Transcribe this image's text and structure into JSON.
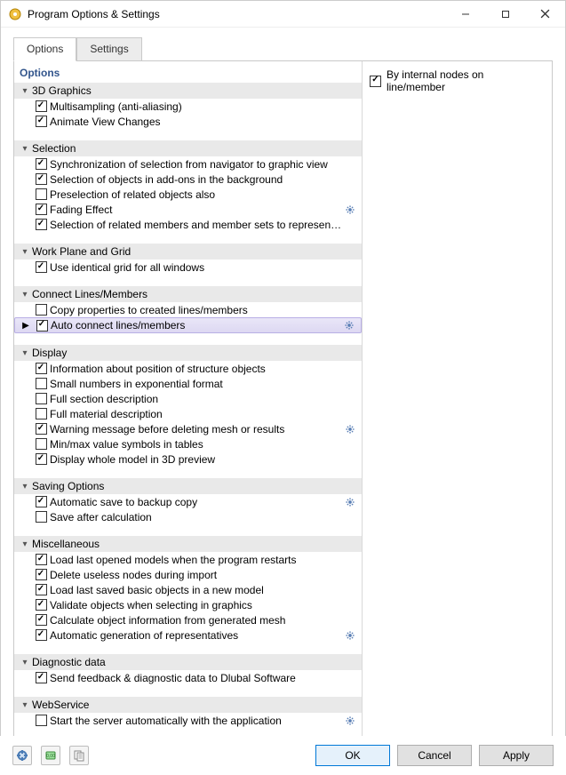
{
  "window": {
    "title": "Program Options & Settings"
  },
  "tabs": {
    "options": "Options",
    "settings": "Settings"
  },
  "panel_title": "Options",
  "groups": [
    {
      "label": "3D Graphics",
      "items": [
        {
          "label": "Multisampling (anti-aliasing)",
          "checked": true
        },
        {
          "label": "Animate View Changes",
          "checked": true
        }
      ]
    },
    {
      "label": "Selection",
      "items": [
        {
          "label": "Synchronization of selection from navigator to graphic view",
          "checked": true
        },
        {
          "label": "Selection of objects in add-ons in the background",
          "checked": true
        },
        {
          "label": "Preselection of related objects also",
          "checked": false
        },
        {
          "label": "Fading Effect",
          "checked": true,
          "gear": true
        },
        {
          "label": "Selection of related members and member sets to representatives",
          "checked": true
        }
      ]
    },
    {
      "label": "Work Plane and Grid",
      "items": [
        {
          "label": "Use identical grid for all windows",
          "checked": true
        }
      ]
    },
    {
      "label": "Connect Lines/Members",
      "items": [
        {
          "label": "Copy properties to created lines/members",
          "checked": false
        },
        {
          "label": "Auto connect lines/members",
          "checked": true,
          "gear": true,
          "selected": true
        }
      ]
    },
    {
      "label": "Display",
      "items": [
        {
          "label": "Information about position of structure objects",
          "checked": true
        },
        {
          "label": "Small numbers in exponential format",
          "checked": false
        },
        {
          "label": "Full section description",
          "checked": false
        },
        {
          "label": "Full material description",
          "checked": false
        },
        {
          "label": "Warning message before deleting mesh or results",
          "checked": true,
          "gear": true
        },
        {
          "label": "Min/max value symbols in tables",
          "checked": false
        },
        {
          "label": "Display whole model in 3D preview",
          "checked": true
        }
      ]
    },
    {
      "label": "Saving Options",
      "items": [
        {
          "label": "Automatic save to backup copy",
          "checked": true,
          "gear": true
        },
        {
          "label": "Save after calculation",
          "checked": false
        }
      ]
    },
    {
      "label": "Miscellaneous",
      "items": [
        {
          "label": "Load last opened models when the program restarts",
          "checked": true
        },
        {
          "label": "Delete useless nodes during import",
          "checked": true
        },
        {
          "label": "Load last saved basic objects in a new model",
          "checked": true
        },
        {
          "label": "Validate objects when selecting in graphics",
          "checked": true
        },
        {
          "label": "Calculate object information from generated mesh",
          "checked": true
        },
        {
          "label": "Automatic generation of representatives",
          "checked": true,
          "gear": true
        }
      ]
    },
    {
      "label": "Diagnostic data",
      "items": [
        {
          "label": "Send feedback & diagnostic data to Dlubal Software",
          "checked": true
        }
      ]
    },
    {
      "label": "WebService",
      "items": [
        {
          "label": "Start the server automatically with the application",
          "checked": false,
          "gear": true
        }
      ]
    }
  ],
  "right_panel": {
    "items": [
      {
        "label": "By internal nodes on line/member",
        "checked": true
      }
    ]
  },
  "buttons": {
    "ok": "OK",
    "cancel": "Cancel",
    "apply": "Apply"
  }
}
